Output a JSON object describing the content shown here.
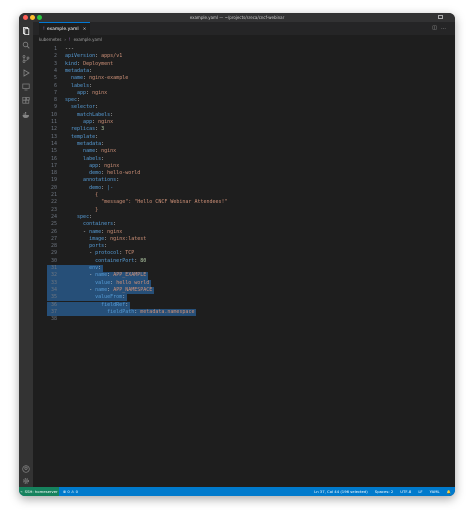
{
  "window": {
    "title": "example.yaml — ~/projects/sreca/cncf-webinar"
  },
  "tab": {
    "filename": "example.yaml",
    "close_glyph": "×"
  },
  "breadcrumb": {
    "folder": "kubernetes",
    "sep": "›",
    "file": "example.yaml"
  },
  "editor": {
    "lines": [
      {
        "n": "1",
        "t": [
          [
            "---",
            "p"
          ]
        ]
      },
      {
        "n": "2",
        "t": [
          [
            "apiVersion",
            "k"
          ],
          [
            ": ",
            "p"
          ],
          [
            "apps/v1",
            "s"
          ]
        ]
      },
      {
        "n": "3",
        "t": [
          [
            "kind",
            "k"
          ],
          [
            ": ",
            "p"
          ],
          [
            "Deployment",
            "s"
          ]
        ]
      },
      {
        "n": "4",
        "t": [
          [
            "metadata",
            "k"
          ],
          [
            ":",
            "p"
          ]
        ]
      },
      {
        "n": "5",
        "t": [
          [
            "  name",
            "k"
          ],
          [
            ": ",
            "p"
          ],
          [
            "nginx-example",
            "s"
          ]
        ]
      },
      {
        "n": "6",
        "t": [
          [
            "  labels",
            "k"
          ],
          [
            ":",
            "p"
          ]
        ]
      },
      {
        "n": "7",
        "t": [
          [
            "    app",
            "k"
          ],
          [
            ": ",
            "p"
          ],
          [
            "nginx",
            "s"
          ]
        ]
      },
      {
        "n": "8",
        "t": [
          [
            "spec",
            "k"
          ],
          [
            ":",
            "p"
          ]
        ]
      },
      {
        "n": "9",
        "t": [
          [
            "  selector",
            "k"
          ],
          [
            ":",
            "p"
          ]
        ]
      },
      {
        "n": "10",
        "t": [
          [
            "    matchLabels",
            "k"
          ],
          [
            ":",
            "p"
          ]
        ]
      },
      {
        "n": "11",
        "t": [
          [
            "      app",
            "k"
          ],
          [
            ": ",
            "p"
          ],
          [
            "nginx",
            "s"
          ]
        ]
      },
      {
        "n": "12",
        "t": [
          [
            "  replicas",
            "k"
          ],
          [
            ": ",
            "p"
          ],
          [
            "3",
            "n"
          ]
        ]
      },
      {
        "n": "13",
        "t": [
          [
            "  template",
            "k"
          ],
          [
            ":",
            "p"
          ]
        ]
      },
      {
        "n": "14",
        "t": [
          [
            "    metadata",
            "k"
          ],
          [
            ":",
            "p"
          ]
        ]
      },
      {
        "n": "15",
        "t": [
          [
            "      name",
            "k"
          ],
          [
            ": ",
            "p"
          ],
          [
            "nginx",
            "s"
          ]
        ]
      },
      {
        "n": "16",
        "t": [
          [
            "      labels",
            "k"
          ],
          [
            ":",
            "p"
          ]
        ]
      },
      {
        "n": "17",
        "t": [
          [
            "        app",
            "k"
          ],
          [
            ": ",
            "p"
          ],
          [
            "nginx",
            "s"
          ]
        ]
      },
      {
        "n": "18",
        "t": [
          [
            "        demo",
            "k"
          ],
          [
            ": ",
            "p"
          ],
          [
            "hello-world",
            "s"
          ]
        ]
      },
      {
        "n": "19",
        "t": [
          [
            "      annotations",
            "k"
          ],
          [
            ":",
            "p"
          ]
        ]
      },
      {
        "n": "20",
        "t": [
          [
            "        demo",
            "k"
          ],
          [
            ": ",
            "p"
          ],
          [
            "|-",
            "k"
          ]
        ]
      },
      {
        "n": "21",
        "t": [
          [
            "          {",
            "s"
          ]
        ]
      },
      {
        "n": "22",
        "t": [
          [
            "            \"message\": \"Hello CNCF Webinar Attendees!\"",
            "s"
          ]
        ]
      },
      {
        "n": "23",
        "t": [
          [
            "          }",
            "s"
          ]
        ]
      },
      {
        "n": "24",
        "t": [
          [
            "    spec",
            "k"
          ],
          [
            ":",
            "p"
          ]
        ]
      },
      {
        "n": "25",
        "t": [
          [
            "      containers",
            "k"
          ],
          [
            ":",
            "p"
          ]
        ]
      },
      {
        "n": "26",
        "t": [
          [
            "      - ",
            "p"
          ],
          [
            "name",
            "k"
          ],
          [
            ": ",
            "p"
          ],
          [
            "nginx",
            "s"
          ]
        ]
      },
      {
        "n": "27",
        "t": [
          [
            "        image",
            "k"
          ],
          [
            ": ",
            "p"
          ],
          [
            "nginx:latest",
            "s"
          ]
        ]
      },
      {
        "n": "28",
        "t": [
          [
            "        ports",
            "k"
          ],
          [
            ":",
            "p"
          ]
        ]
      },
      {
        "n": "29",
        "t": [
          [
            "        - ",
            "p"
          ],
          [
            "protocol",
            "k"
          ],
          [
            ": ",
            "p"
          ],
          [
            "TCP",
            "s"
          ]
        ]
      },
      {
        "n": "30",
        "t": [
          [
            "          containerPort",
            "k"
          ],
          [
            ": ",
            "p"
          ],
          [
            "80",
            "n"
          ]
        ]
      },
      {
        "n": "31",
        "t": [
          [
            "        env",
            "k"
          ],
          [
            ":",
            "p"
          ]
        ]
      },
      {
        "n": "32",
        "t": [
          [
            "        - ",
            "p"
          ],
          [
            "name",
            "k"
          ],
          [
            ": ",
            "p"
          ],
          [
            "APP_EXAMPLE",
            "s"
          ]
        ]
      },
      {
        "n": "33",
        "t": [
          [
            "          value",
            "k"
          ],
          [
            ": ",
            "p"
          ],
          [
            "hello world",
            "s"
          ]
        ]
      },
      {
        "n": "34",
        "t": [
          [
            "        - ",
            "p"
          ],
          [
            "name",
            "k"
          ],
          [
            ": ",
            "p"
          ],
          [
            "APP_NAMESPACE",
            "s"
          ]
        ]
      },
      {
        "n": "35",
        "t": [
          [
            "          valueFrom",
            "k"
          ],
          [
            ":",
            "p"
          ]
        ]
      },
      {
        "n": "36",
        "t": [
          [
            "            fieldRef",
            "k"
          ],
          [
            ":",
            "p"
          ]
        ]
      },
      {
        "n": "37",
        "t": [
          [
            "              fieldPath",
            "k"
          ],
          [
            ": ",
            "p"
          ],
          [
            "metadata.namespace",
            "s"
          ]
        ]
      },
      {
        "n": "38",
        "t": []
      }
    ]
  },
  "statusbar": {
    "remote": "SSH: homeserver",
    "problems": "⊗ 0 ⚠ 0",
    "position": "Ln 37, Col 44 (196 selected)",
    "spaces": "Spaces: 2",
    "encoding": "UTF-8",
    "eol": "LF",
    "language": "YAML",
    "bell": "🔔"
  },
  "colors": {
    "statusbar": "#007acc",
    "keyword": "#569cd6",
    "string": "#ce9178",
    "number": "#b5cea8",
    "selection": "#264f78"
  },
  "icons": [
    "files-icon",
    "search-icon",
    "source-control-icon",
    "run-debug-icon",
    "remote-explorer-icon",
    "extensions-icon",
    "docker-icon",
    "accounts-icon",
    "settings-gear-icon"
  ]
}
